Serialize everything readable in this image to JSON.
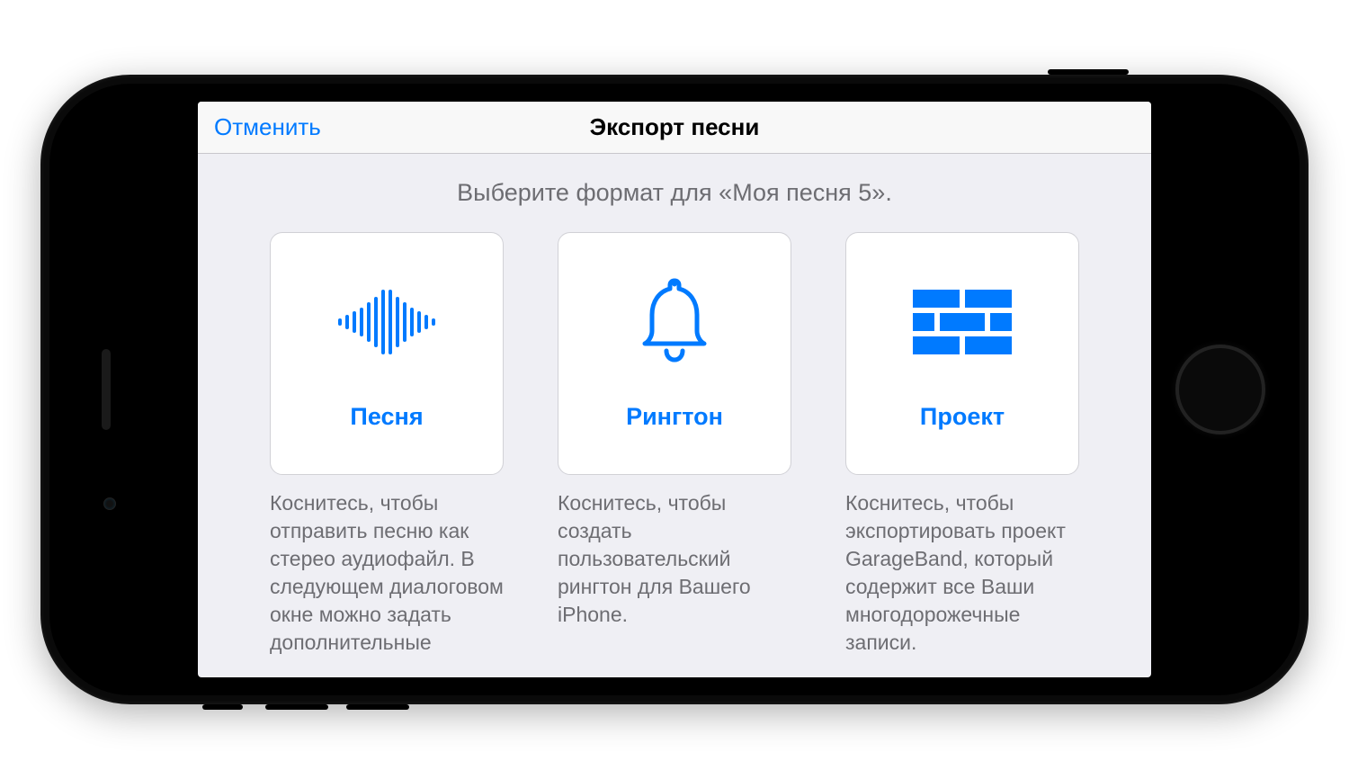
{
  "navbar": {
    "cancel": "Отменить",
    "title": "Экспорт песни"
  },
  "subtitle": "Выберите формат для «Моя песня 5».",
  "cards": {
    "song": {
      "label": "Песня",
      "desc": "Коснитесь, чтобы отправить песню как стерео аудиофайл. В следующем диалоговом окне можно задать дополнительные"
    },
    "ringtone": {
      "label": "Рингтон",
      "desc": "Коснитесь, чтобы создать пользовательский рингтон для Вашего iPhone."
    },
    "project": {
      "label": "Проект",
      "desc": "Коснитесь, чтобы экспортировать проект GarageBand, который содержит все Ваши многодорожечные записи."
    }
  }
}
